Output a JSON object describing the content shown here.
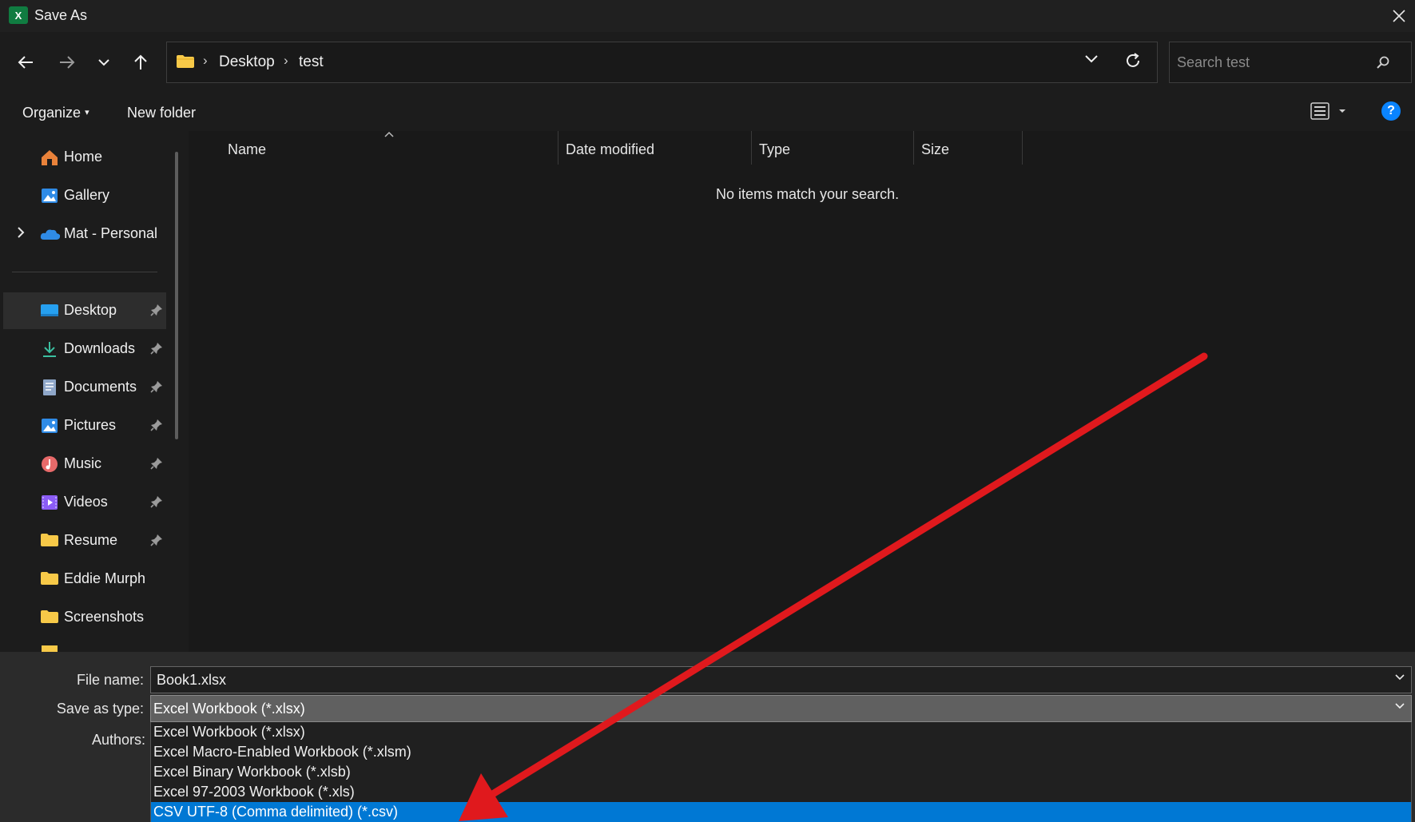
{
  "window": {
    "title": "Save As",
    "app_icon_letter": "X",
    "app_icon_color": "#107c41"
  },
  "nav": {
    "breadcrumbs": [
      "Desktop",
      "test"
    ],
    "search_placeholder": "Search test"
  },
  "commands": {
    "organize": "Organize",
    "new_folder": "New folder",
    "help": "?"
  },
  "sidebar": {
    "items": [
      {
        "label": "Home",
        "icon": "home-icon"
      },
      {
        "label": "Gallery",
        "icon": "gallery-icon"
      },
      {
        "label": "Mat - Personal",
        "icon": "onedrive-icon"
      },
      {
        "label": "Desktop",
        "icon": "desktop-icon",
        "pinned": true,
        "selected": true
      },
      {
        "label": "Downloads",
        "icon": "downloads-icon",
        "pinned": true
      },
      {
        "label": "Documents",
        "icon": "documents-icon",
        "pinned": true
      },
      {
        "label": "Pictures",
        "icon": "pictures-icon",
        "pinned": true
      },
      {
        "label": "Music",
        "icon": "music-icon",
        "pinned": true
      },
      {
        "label": "Videos",
        "icon": "videos-icon",
        "pinned": true
      },
      {
        "label": "Resume",
        "icon": "folder-icon",
        "pinned": true
      },
      {
        "label": "Eddie Murph",
        "icon": "folder-icon"
      },
      {
        "label": "Screenshots",
        "icon": "folder-icon"
      }
    ]
  },
  "file_list": {
    "columns": [
      "Name",
      "Date modified",
      "Type",
      "Size"
    ],
    "empty_message": "No items match your search."
  },
  "form": {
    "file_name_label": "File name:",
    "file_name_value": "Book1.xlsx",
    "save_as_type_label": "Save as type:",
    "save_as_type_value": "Excel Workbook (*.xlsx)",
    "authors_label": "Authors:"
  },
  "save_type_options": [
    "Excel Workbook (*.xlsx)",
    "Excel Macro-Enabled Workbook (*.xlsm)",
    "Excel Binary Workbook (*.xlsb)",
    "Excel 97-2003 Workbook (*.xls)",
    "CSV UTF-8 (Comma delimited) (*.csv)"
  ],
  "colors": {
    "accent": "#0078d4",
    "annotation_arrow": "#e0191d"
  }
}
